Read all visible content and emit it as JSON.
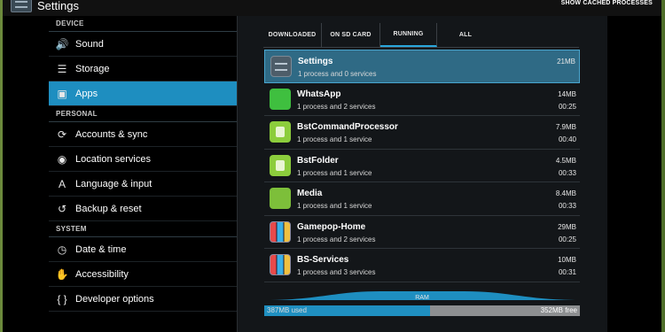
{
  "titlebar": {
    "title": "Settings",
    "action": "SHOW CACHED PROCESSES"
  },
  "sidebar": {
    "sections": [
      {
        "header": "DEVICE",
        "items": [
          {
            "label": "Sound",
            "icon": "volume-icon"
          },
          {
            "label": "Storage",
            "icon": "storage-icon"
          },
          {
            "label": "Apps",
            "icon": "apps-icon",
            "active": true
          }
        ]
      },
      {
        "header": "PERSONAL",
        "items": [
          {
            "label": "Accounts & sync",
            "icon": "sync-icon"
          },
          {
            "label": "Location services",
            "icon": "location-icon"
          },
          {
            "label": "Language & input",
            "icon": "keyboard-icon"
          },
          {
            "label": "Backup & reset",
            "icon": "backup-icon"
          }
        ]
      },
      {
        "header": "SYSTEM",
        "items": [
          {
            "label": "Date & time",
            "icon": "clock-icon"
          },
          {
            "label": "Accessibility",
            "icon": "hand-icon"
          },
          {
            "label": "Developer options",
            "icon": "braces-icon"
          }
        ]
      }
    ]
  },
  "tabs": [
    "DOWNLOADED",
    "ON SD CARD",
    "RUNNING",
    "ALL"
  ],
  "active_tab": "RUNNING",
  "apps": [
    {
      "name": "Settings",
      "detail": "1 process and 0 services",
      "size": "21MB",
      "time": "",
      "icon": "settings-app-icon",
      "selected": true
    },
    {
      "name": "WhatsApp",
      "detail": "1 process and 2 services",
      "size": "14MB",
      "time": "00:25",
      "icon": "whatsapp-icon"
    },
    {
      "name": "BstCommandProcessor",
      "detail": "1 process and 1 service",
      "size": "7.9MB",
      "time": "00:40",
      "icon": "android-icon"
    },
    {
      "name": "BstFolder",
      "detail": "1 process and 1 service",
      "size": "4.5MB",
      "time": "00:33",
      "icon": "android-icon"
    },
    {
      "name": "Media",
      "detail": "1 process and 1 service",
      "size": "8.4MB",
      "time": "00:33",
      "icon": "media-icon"
    },
    {
      "name": "Gamepop-Home",
      "detail": "1 process and 2 services",
      "size": "29MB",
      "time": "00:25",
      "icon": "gamepop-icon"
    },
    {
      "name": "BS-Services",
      "detail": "1 process and 3 services",
      "size": "10MB",
      "time": "00:31",
      "icon": "bs-services-icon"
    }
  ],
  "ram": {
    "label": "RAM",
    "used": "387MB used",
    "free": "352MB free",
    "used_fraction": 0.524
  },
  "colors": {
    "accent": "#1e8ec0",
    "selected_row": "#2f6a85"
  }
}
